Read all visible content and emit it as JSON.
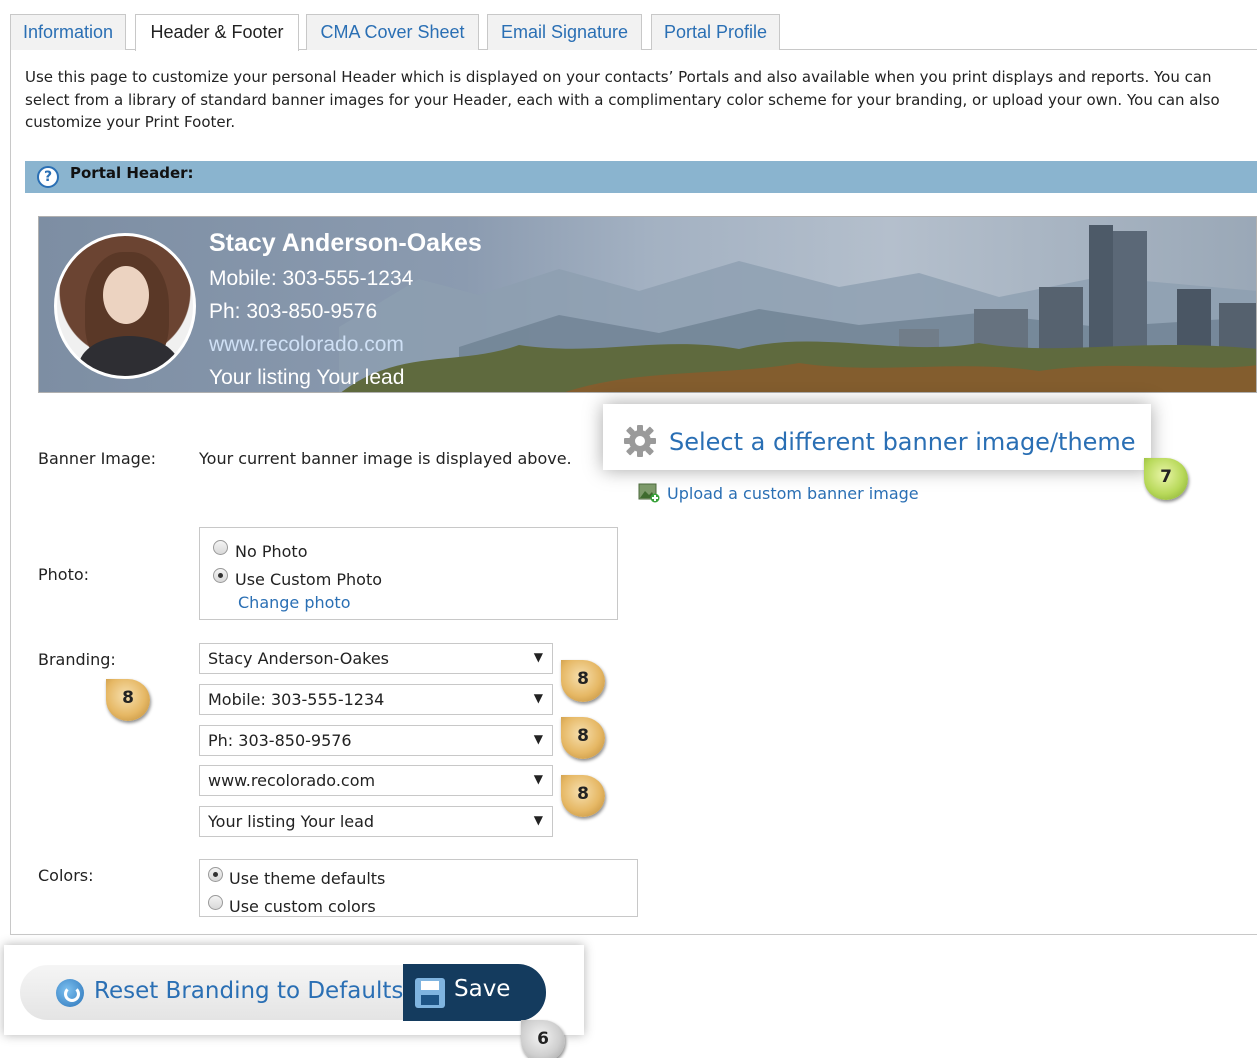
{
  "tabs": [
    {
      "label": "Information",
      "active": false
    },
    {
      "label": "Header & Footer",
      "active": true
    },
    {
      "label": "CMA Cover Sheet",
      "active": false
    },
    {
      "label": "Email Signature",
      "active": false
    },
    {
      "label": "Portal Profile",
      "active": false
    }
  ],
  "intro": "Use this page to customize your personal Header which is displayed on your contacts’ Portals and also available when you print displays and reports. You can select from a library of standard banner images for your Header, each with a complimentary color scheme for your branding, or upload your own. You can also customize your Print Footer.",
  "section": {
    "title": "Portal Header:",
    "icon": "help-icon"
  },
  "banner": {
    "name": "Stacy Anderson-Oakes",
    "mobile": "Mobile: 303-555-1234",
    "phone": "Ph: 303-850-9576",
    "website": "www.recolorado.com",
    "tagline": "Your listing Your lead"
  },
  "banner_image": {
    "label": "Banner Image:",
    "note": "Your current banner image is displayed above.",
    "select_theme": "Select a different banner image/theme",
    "upload_custom": "Upload a custom banner image"
  },
  "photo": {
    "label": "Photo:",
    "options": [
      {
        "label": "No Photo",
        "selected": false
      },
      {
        "label": "Use Custom Photo",
        "selected": true
      }
    ],
    "change_link": "Change photo"
  },
  "branding": {
    "label": "Branding:",
    "selects": [
      "Stacy Anderson-Oakes",
      "Mobile: 303-555-1234",
      "Ph: 303-850-9576",
      "www.recolorado.com",
      "Your listing Your lead"
    ]
  },
  "colors": {
    "label": "Colors:",
    "options": [
      {
        "label": "Use theme defaults",
        "selected": true
      },
      {
        "label": "Use custom colors",
        "selected": false
      }
    ]
  },
  "actions": {
    "reset": "Reset Branding to Defaults",
    "save": "Save"
  },
  "badges": {
    "theme": "7",
    "branding": "8",
    "save": "6"
  },
  "colors_palette": {
    "accent": "#2a6fb4",
    "section_bar": "#8ab4cf",
    "save_bg": "#143b5e"
  }
}
